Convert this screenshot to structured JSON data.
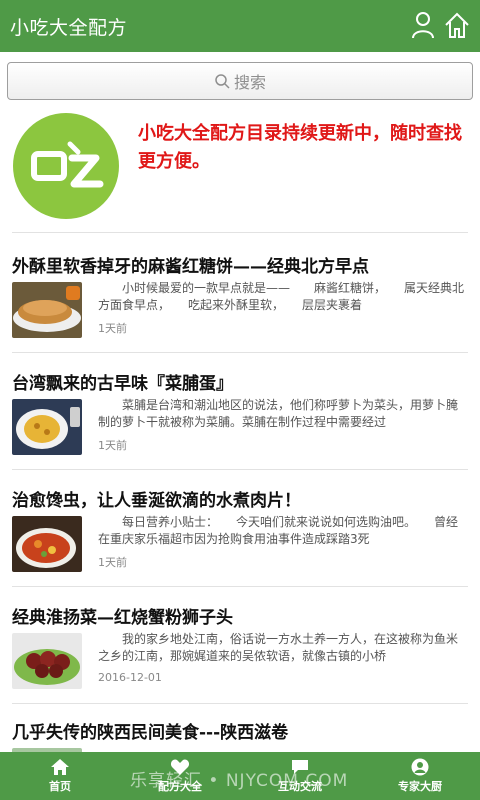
{
  "app": {
    "title": "小吃大全配方",
    "accent": "#4f9a47",
    "banner_color": "#e01818"
  },
  "header_icons": [
    "user-icon",
    "home-icon"
  ],
  "search": {
    "placeholder": "搜索"
  },
  "banner": {
    "logo_icon": "chi-logo-icon",
    "text": "小吃大全配方目录持续更新中，随时查找更方便。"
  },
  "articles": [
    {
      "title": "外酥里软香掉牙的麻酱红糖饼——经典北方早点",
      "summary": "小时候最爱的一款早点就是——　　麻酱红糖饼，　　属天经典北方面食早点，　　吃起来外酥里软，　　层层夹裹着",
      "time": "1天前"
    },
    {
      "title": "台湾飘来的古早味『菜脯蛋』",
      "summary": "菜脯是台湾和潮汕地区的说法，他们称呼萝卜为菜头，用萝卜腌制的萝卜干就被称为菜脯。菜脯在制作过程中需要经过",
      "time": "1天前"
    },
    {
      "title": "治愈馋虫，让人垂涎欲滴的水煮肉片！",
      "summary": "每日营养小贴士：　　今天咱们就来说说如何选购油吧。　　曾经在重庆家乐福超市因为抢购食用油事件造成踩踏3死",
      "time": "1天前"
    },
    {
      "title": "经典淮扬菜—红烧蟹粉狮子头",
      "summary": "我的家乡地处江南，俗话说一方水土养一方人，在这被称为鱼米之乡的江南，那婉娓道来的吴侬软语，就像古镇的小桥",
      "time": "2016-12-01"
    },
    {
      "title": "几乎失传的陕西民间美食---陕西滋卷",
      "summary": "",
      "time": ""
    }
  ],
  "bottom_tabs": [
    {
      "label": "首页",
      "icon": "home-icon"
    },
    {
      "label": "配方大全",
      "icon": "heart-icon"
    },
    {
      "label": "互动交流",
      "icon": "chat-icon"
    },
    {
      "label": "专家大厨",
      "icon": "user-circle-icon"
    }
  ],
  "watermark": "乐享轻汇 • NJYCOM.COM"
}
